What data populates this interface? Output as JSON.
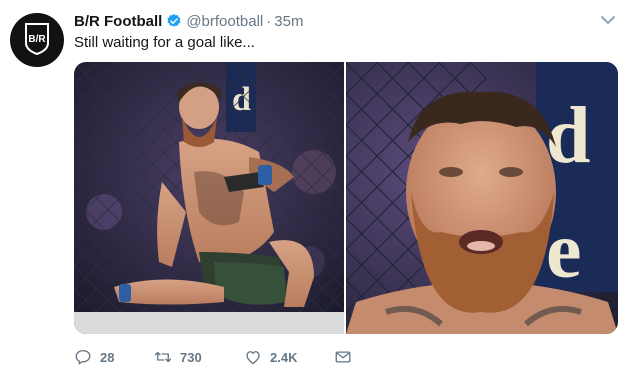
{
  "tweet": {
    "display_name": "B/R Football",
    "handle": "@brfootball",
    "separator": "·",
    "time": "35m",
    "text": "Still waiting for a goal like...",
    "avatar_logo_text": "B/R",
    "images": [
      {
        "description": "fighter sitting against cage"
      },
      {
        "description": "close-up of bearded fighter's face"
      }
    ],
    "background_letters": [
      "d",
      "e"
    ],
    "actions": {
      "replies": "28",
      "retweets": "730",
      "likes": "2.4K"
    }
  },
  "icons": {
    "verified": "verified-badge-icon",
    "caret": "chevron-down-icon",
    "reply": "reply-icon",
    "retweet": "retweet-icon",
    "like": "heart-icon",
    "dm": "envelope-icon"
  },
  "colors": {
    "verified": "#1da1f2",
    "muted": "#657786",
    "text": "#14171a"
  }
}
